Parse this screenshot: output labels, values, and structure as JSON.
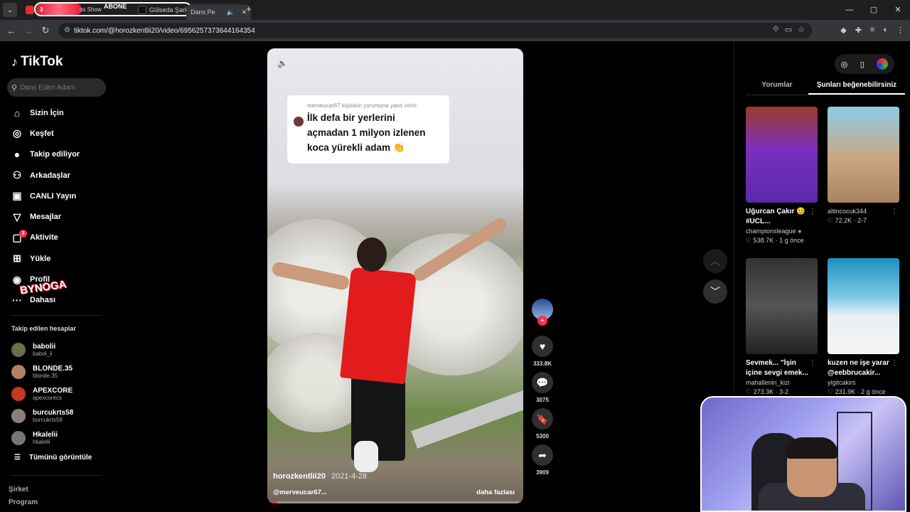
{
  "browser": {
    "tabs": [
      {
        "label": "ABONE",
        "kind": "youtube"
      },
      {
        "label": "Gülseda Şarkısı",
        "kind": "tiktok"
      },
      {
        "label": "Dans Pe",
        "kind": "tiktok"
      }
    ],
    "overlay_badge": "3",
    "overlay_text": "os Show",
    "url": "tiktok.com/@horozkentlii20/video/6956257373644164354",
    "window_controls": [
      "—",
      "▢",
      "✕"
    ]
  },
  "sidebar": {
    "logo_text": "TikTok",
    "search_placeholder": "Dans Eden Adam",
    "menu": [
      {
        "label": "Sizin İçin",
        "icon": "home-icon",
        "glyph": "⌂"
      },
      {
        "label": "Keşfet",
        "icon": "compass-icon",
        "glyph": "◎"
      },
      {
        "label": "Takip ediliyor",
        "icon": "following-avatar-icon",
        "glyph": "●"
      },
      {
        "label": "Arkadaşlar",
        "icon": "friends-icon",
        "glyph": "⚇"
      },
      {
        "label": "CANLI Yayın",
        "icon": "live-icon",
        "glyph": "▣"
      },
      {
        "label": "Mesajlar",
        "icon": "messages-icon",
        "glyph": "▽"
      },
      {
        "label": "Aktivite",
        "icon": "activity-icon",
        "glyph": "▢",
        "badge": "3"
      },
      {
        "label": "Yükle",
        "icon": "upload-icon",
        "glyph": "⊞"
      },
      {
        "label": "Profil",
        "icon": "profile-icon",
        "glyph": "◉"
      },
      {
        "label": "Dahası",
        "icon": "more-icon",
        "glyph": "···"
      }
    ],
    "following_title": "Takip edilen hesaplar",
    "following": [
      {
        "name": "babolii",
        "handle": "babol_ii",
        "color": "#6b6f4a"
      },
      {
        "name": "BLONDE.35",
        "handle": "blonde.35",
        "color": "#b08060"
      },
      {
        "name": "APEXCORE",
        "handle": "apexcorecs",
        "color": "#c23b1e"
      },
      {
        "name": "burcukrts58",
        "handle": "burcukrts58",
        "color": "#8a7f7a"
      },
      {
        "name": "Hkalelii",
        "handle": "hkalelii",
        "color": "#777"
      }
    ],
    "see_all": "Tümünü görüntüle",
    "footer": [
      "Şirket",
      "Program"
    ],
    "watermark": "BYNOGA"
  },
  "video": {
    "caption_header": "merveucar67 kişisinin yorumuna yanıt verin",
    "caption_lines": [
      "İlk defa bir yerlerini",
      "açmadan 1 milyon izlenen",
      "koca yürekli adam 👏"
    ],
    "author": "horozkentlii20",
    "date": "2021-4-28",
    "mention": "@merveucar67...",
    "more_label": "daha fazlası",
    "progress": 0.04
  },
  "actions": {
    "likes": "333.8K",
    "comments": "3075",
    "saves": "5300",
    "shares": "3909"
  },
  "right_panel": {
    "tabs": [
      "Yorumlar",
      "Şunları beğenebilirsiniz"
    ],
    "active_tab": 1,
    "cards": [
      {
        "title": "Uğurcan Çakır 😊 #UCL...",
        "user": "championsleague",
        "likes": "538.7K",
        "age": "1 g önce",
        "verified": true,
        "thumb": "linear-gradient(180deg,#9a3b2a 0%,#7a2fbf 45%,#5a2aa8 100%)"
      },
      {
        "title": "",
        "user": "altincocuk344",
        "likes": "72.2K",
        "age": "2-7",
        "verified": false,
        "thumb": "linear-gradient(180deg,#8ecbe6 0%,#c9a680 55%,#a88460 100%)"
      },
      {
        "title": "Sevmek... \"İşin içine sevgi emek...",
        "user": "mahallenin_kizi",
        "likes": "273.3K",
        "age": "3-2",
        "verified": false,
        "thumb": "linear-gradient(180deg,#333 0%,#555 50%,#222 100%)"
      },
      {
        "title": "kuzen ne işe yarar @eebbrucakir...",
        "user": "yigitcakirs",
        "likes": "231.9K",
        "age": "2 g önce",
        "verified": false,
        "thumb": "linear-gradient(180deg,#1c8fbf 0%,#7cc9e8 40%,#e8eef2 60%,#f5f5f5 100%)"
      }
    ]
  }
}
